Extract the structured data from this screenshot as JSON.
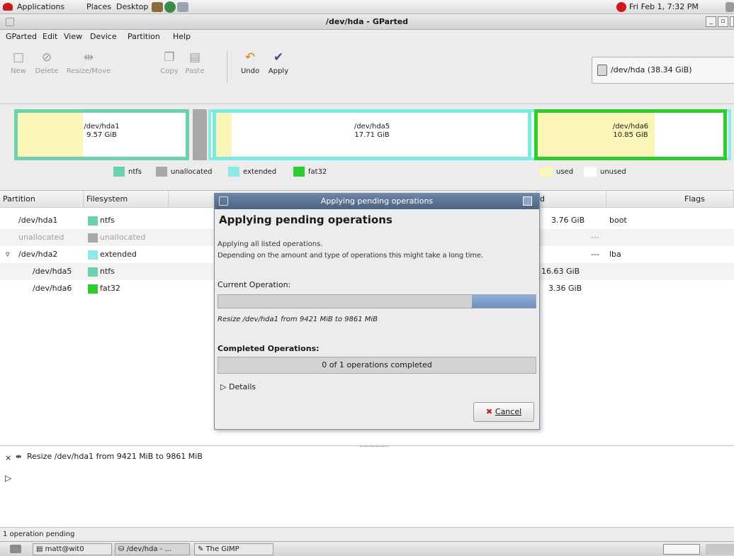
{
  "topbar": {
    "menus": [
      "Applications",
      "Places",
      "Desktop"
    ],
    "clock": "Fri Feb 1,  7:32 PM"
  },
  "window": {
    "title": "/dev/hda - GParted"
  },
  "menubar": {
    "items": [
      "GParted",
      "Edit",
      "View",
      "Device",
      "Partition",
      "Help"
    ]
  },
  "toolbar": {
    "new": "New",
    "delete": "Delete",
    "resize": "Resize/Move",
    "copy": "Copy",
    "paste": "Paste",
    "undo": "Undo",
    "apply": "Apply",
    "device": "/dev/hda  (38.34 GiB)"
  },
  "diskmap": {
    "p1": {
      "name": "/dev/hda1",
      "size": "9.57 GiB",
      "used_fraction": 0.39
    },
    "p5": {
      "name": "/dev/hda5",
      "size": "17.71 GiB",
      "used_fraction": 0.05
    },
    "p6": {
      "name": "/dev/hda6",
      "size": "10.85 GiB",
      "used_fraction": 0.63
    }
  },
  "legend": {
    "ntfs": "ntfs",
    "unallocated": "unallocated",
    "extended": "extended",
    "fat32": "fat32",
    "used": "used",
    "unused": "unused"
  },
  "colors": {
    "ntfs": "#6cd1ac",
    "unallocated": "#a9a9a9",
    "extended": "#8fe8e8",
    "fat32": "#2fcc2f",
    "used": "#fbf6b8",
    "unused": "#ffffff"
  },
  "table": {
    "headers": {
      "partition": "Partition",
      "filesystem": "Filesystem",
      "used": "d",
      "flags": "Flags"
    },
    "rows": [
      {
        "partition": "/dev/hda1",
        "fs": "ntfs",
        "used": "3.76 GiB",
        "flags": "boot"
      },
      {
        "partition": "unallocated",
        "fs": "unallocated",
        "used": "---",
        "flags": ""
      },
      {
        "partition": "/dev/hda2",
        "fs": "extended",
        "used": "---",
        "flags": "lba"
      },
      {
        "partition": "/dev/hda5",
        "fs": "ntfs",
        "used": "16.63 GiB",
        "flags": ""
      },
      {
        "partition": "/dev/hda6",
        "fs": "fat32",
        "used": "3.36 GiB",
        "flags": ""
      }
    ]
  },
  "dialog": {
    "title": "Applying pending operations",
    "heading": "Applying pending operations",
    "line1": "Applying all listed operations.",
    "line2": "Depending on the amount and type of operations this might take a long time.",
    "current_label": "Current Operation:",
    "progress_fraction": 0.2,
    "current_op": "Resize /dev/hda1 from 9421 MiB to 9861 MiB",
    "completed_label": "Completed Operations:",
    "completed_text": "0 of 1 operations completed",
    "details": "Details",
    "cancel": "Cancel"
  },
  "log": {
    "entry": "Resize /dev/hda1 from 9421 MiB to 9861 MiB"
  },
  "statusbar": "1 operation pending",
  "taskbar": {
    "t1": "matt@wit0",
    "t2": "/dev/hda - ...",
    "t3": "The GIMP"
  }
}
